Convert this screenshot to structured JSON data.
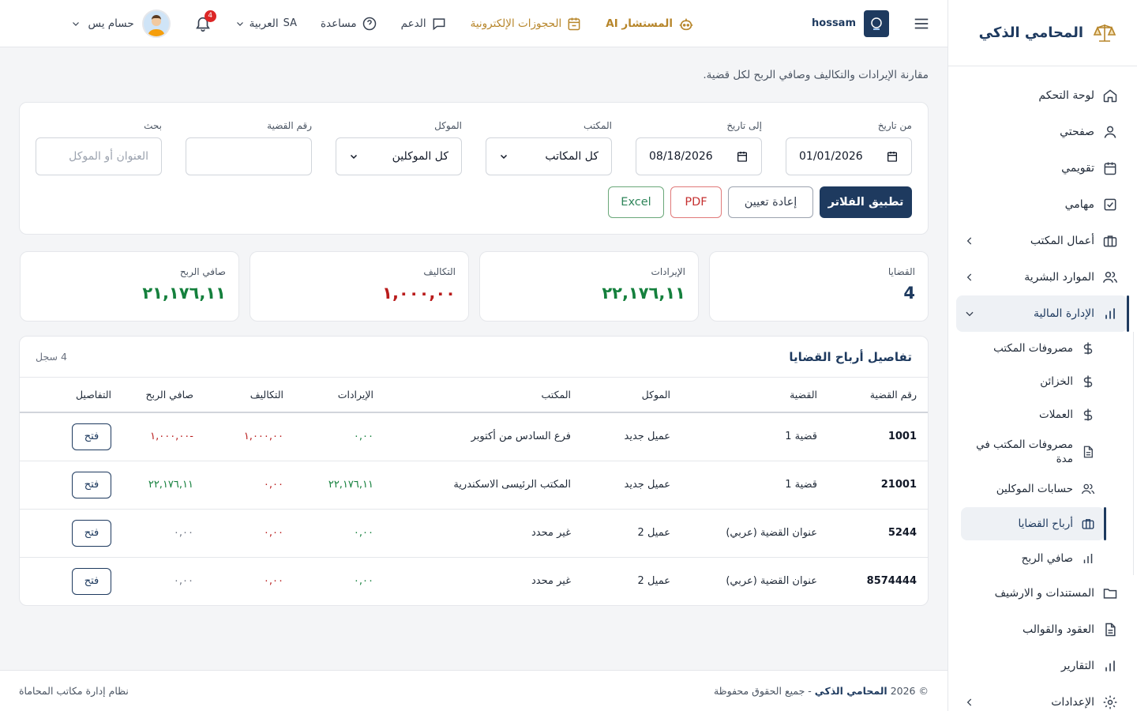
{
  "sidebar": {
    "brand": "المحامي الذكي",
    "items": [
      {
        "label": "لوحة التحكم"
      },
      {
        "label": "صفحتي"
      },
      {
        "label": "تقويمي"
      },
      {
        "label": "مهامي"
      },
      {
        "label": "أعمال المكتب"
      },
      {
        "label": "الموارد البشرية"
      },
      {
        "label": "الإدارة المالية"
      },
      {
        "label": "المستندات و الارشيف"
      },
      {
        "label": "العقود والقوالب"
      },
      {
        "label": "التقارير"
      },
      {
        "label": "الإعدادات"
      }
    ],
    "finance_sub": [
      {
        "label": "مصروفات المكتب"
      },
      {
        "label": "الخزائن"
      },
      {
        "label": "العملات"
      },
      {
        "label": "مصروفات المكتب في مدة"
      },
      {
        "label": "حسابات الموكلين"
      },
      {
        "label": "أرباح القضايا"
      },
      {
        "label": "صافي الربح"
      }
    ]
  },
  "topbar": {
    "user_name": "حسام يس",
    "notif_count": "4",
    "lang_code": "SA",
    "lang_label": "العربية",
    "help": "مساعدة",
    "support": "الدعم",
    "bookings": "الحجوزات الإلكترونية",
    "ai": "المستشار AI",
    "org": "hossam"
  },
  "page": {
    "subtitle": "مقارنة الإيرادات والتكاليف وصافي الربح لكل قضية."
  },
  "filters": {
    "from_label": "من تاريخ",
    "from_value": "01/01/2026",
    "to_label": "إلى تاريخ",
    "to_value": "08/18/2026",
    "office_label": "المكتب",
    "office_value": "كل المكاتب",
    "client_label": "الموكل",
    "client_value": "كل الموكلين",
    "case_label": "رقم القضية",
    "case_value": "",
    "search_label": "بحث",
    "search_placeholder": "العنوان أو الموكل",
    "apply": "تطبيق الفلاتر",
    "reset": "إعادة تعيين",
    "pdf": "PDF",
    "excel": "Excel"
  },
  "stats": {
    "cases_label": "القضايا",
    "cases_value": "4",
    "revenue_label": "الإيرادات",
    "revenue_value": "٢٢,١٧٦,١١",
    "costs_label": "التكاليف",
    "costs_value": "١,٠٠٠,٠٠",
    "net_label": "صافي الربح",
    "net_value": "٢١,١٧٦,١١"
  },
  "table": {
    "title": "تفاصيل أرباح القضايا",
    "count": "4 سجل",
    "headers": [
      "رقم القضية",
      "القضية",
      "الموكل",
      "المكتب",
      "الإيرادات",
      "التكاليف",
      "صافي الربح",
      "التفاصيل"
    ],
    "open_label": "فتح",
    "rows": [
      {
        "no": "1001",
        "case": "قضية 1",
        "client": "عميل جديد",
        "office": "فرع السادس من أكتوبر",
        "revenue": "٠,٠٠",
        "costs": "١,٠٠٠,٠٠",
        "net": "-١,٠٠٠,٠٠",
        "net_class": "red",
        "rev_class": "green",
        "cost_class": "red"
      },
      {
        "no": "21001",
        "case": "قضية 1",
        "client": "عميل جديد",
        "office": "المكتب الرئيسى الاسكندرية",
        "revenue": "٢٢,١٧٦,١١",
        "costs": "٠,٠٠",
        "net": "٢٢,١٧٦,١١",
        "net_class": "green",
        "rev_class": "green",
        "cost_class": "red"
      },
      {
        "no": "5244",
        "case": "عنوان القضية (عربي)",
        "client": "عميل 2",
        "office": "غير محدد",
        "revenue": "٠,٠٠",
        "costs": "٠,٠٠",
        "net": "٠,٠٠",
        "net_class": "grey",
        "rev_class": "green",
        "cost_class": "red"
      },
      {
        "no": "8574444",
        "case": "عنوان القضية (عربي)",
        "client": "عميل 2",
        "office": "غير محدد",
        "revenue": "٠,٠٠",
        "costs": "٠,٠٠",
        "net": "٠,٠٠",
        "net_class": "grey",
        "rev_class": "green",
        "cost_class": "red"
      }
    ]
  },
  "footer": {
    "copy_prefix": "© 2026",
    "copy_brand": "المحامي الذكي",
    "copy_suffix": "- جميع الحقوق محفوظة",
    "system": "نظام إدارة مكاتب المحاماة"
  },
  "colors": {
    "primary": "#1e3a5f",
    "gold": "#b7862b",
    "green": "#15803d",
    "red": "#b91c1c"
  }
}
